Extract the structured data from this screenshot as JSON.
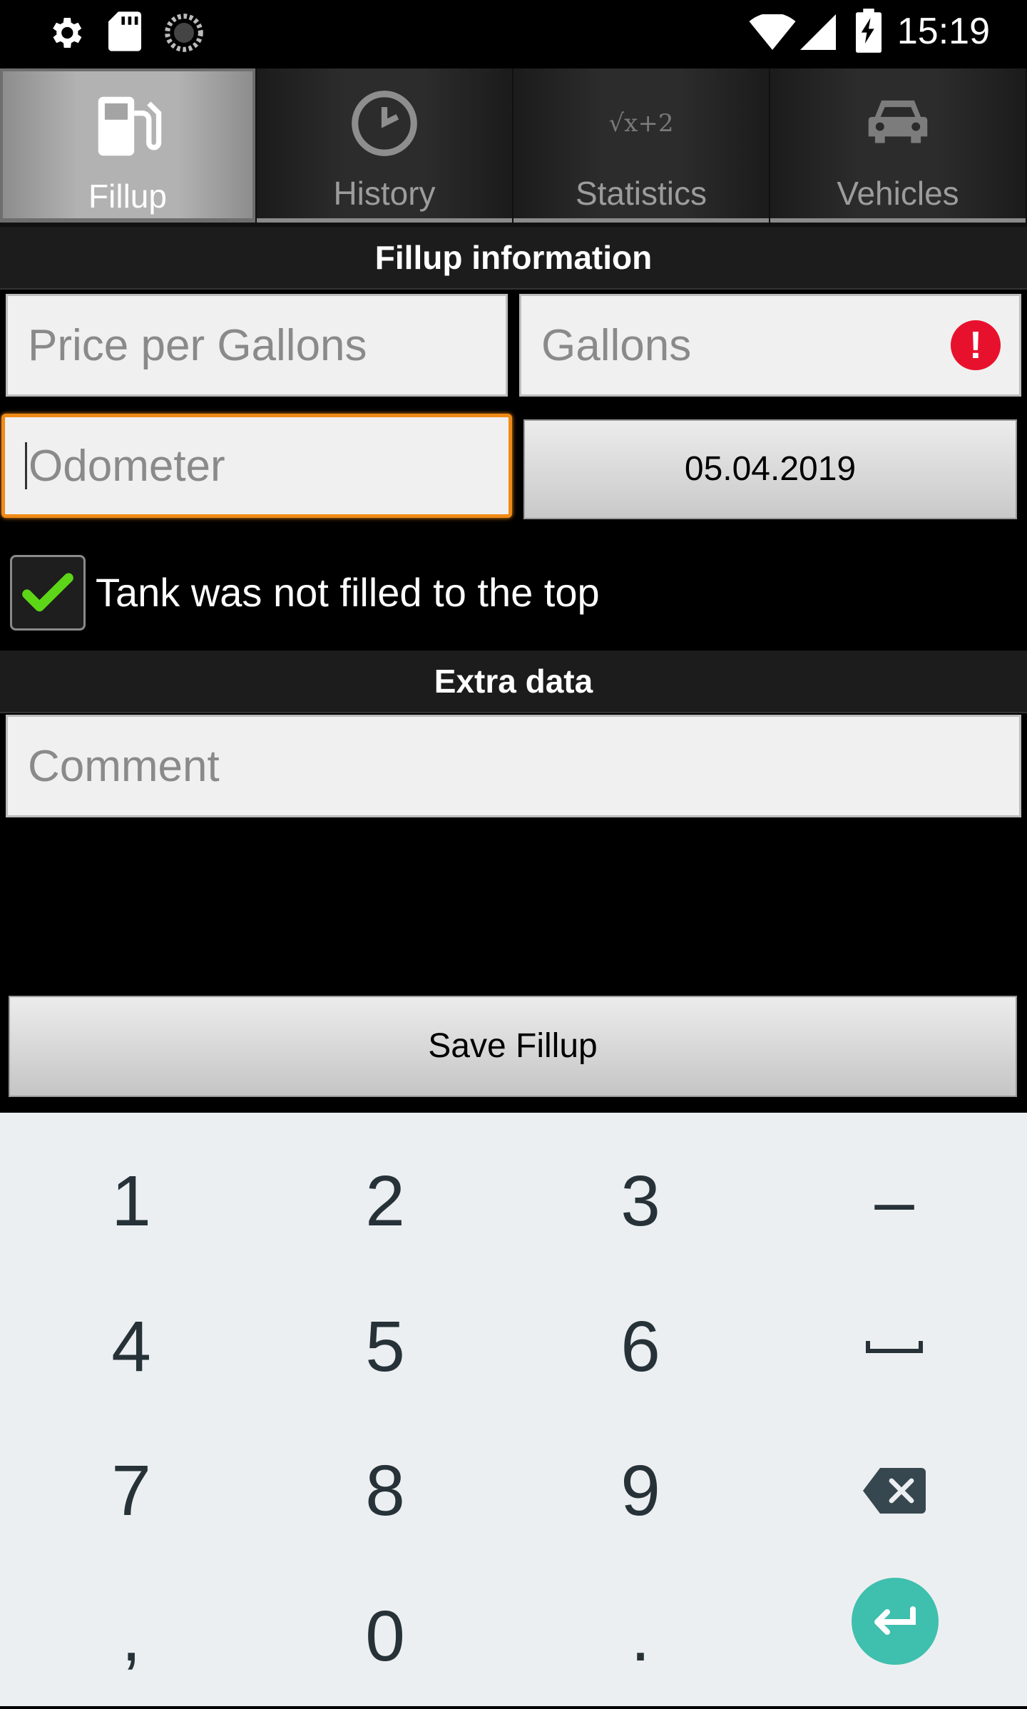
{
  "status_bar": {
    "time": "15:19",
    "icons": [
      "settings-icon",
      "sd-card-icon",
      "sync-icon",
      "wifi-icon",
      "signal-icon",
      "battery-charging-icon"
    ]
  },
  "tabs": [
    {
      "label": "Fillup",
      "icon": "fuel-pump-icon",
      "active": true
    },
    {
      "label": "History",
      "icon": "clock-icon",
      "active": false
    },
    {
      "label": "Statistics",
      "icon": "formula-icon",
      "icon_text": "√x+2",
      "active": false
    },
    {
      "label": "Vehicles",
      "icon": "car-icon",
      "active": false
    }
  ],
  "fillup_section": {
    "title": "Fillup information",
    "price_placeholder": "Price per Gallons",
    "gallons_placeholder": "Gallons",
    "gallons_error_icon": "!",
    "odometer_placeholder": "Odometer",
    "date": "05.04.2019",
    "tank_checkbox_label": "Tank was not filled to the top",
    "tank_checkbox_checked": true
  },
  "extra_section": {
    "title": "Extra data",
    "comment_placeholder": "Comment"
  },
  "save_button": "Save Fillup",
  "keyboard": {
    "row1": [
      "1",
      "2",
      "3",
      "–"
    ],
    "row2": [
      "4",
      "5",
      "6",
      "space-icon"
    ],
    "row3": [
      "7",
      "8",
      "9",
      "backspace-icon"
    ],
    "row4": [
      ",",
      "0",
      ".",
      "enter-icon"
    ],
    "enter_color": "#3fbfad"
  },
  "colors": {
    "focus_border": "#f08a17",
    "error": "#e8112d",
    "check": "#5cd616"
  }
}
